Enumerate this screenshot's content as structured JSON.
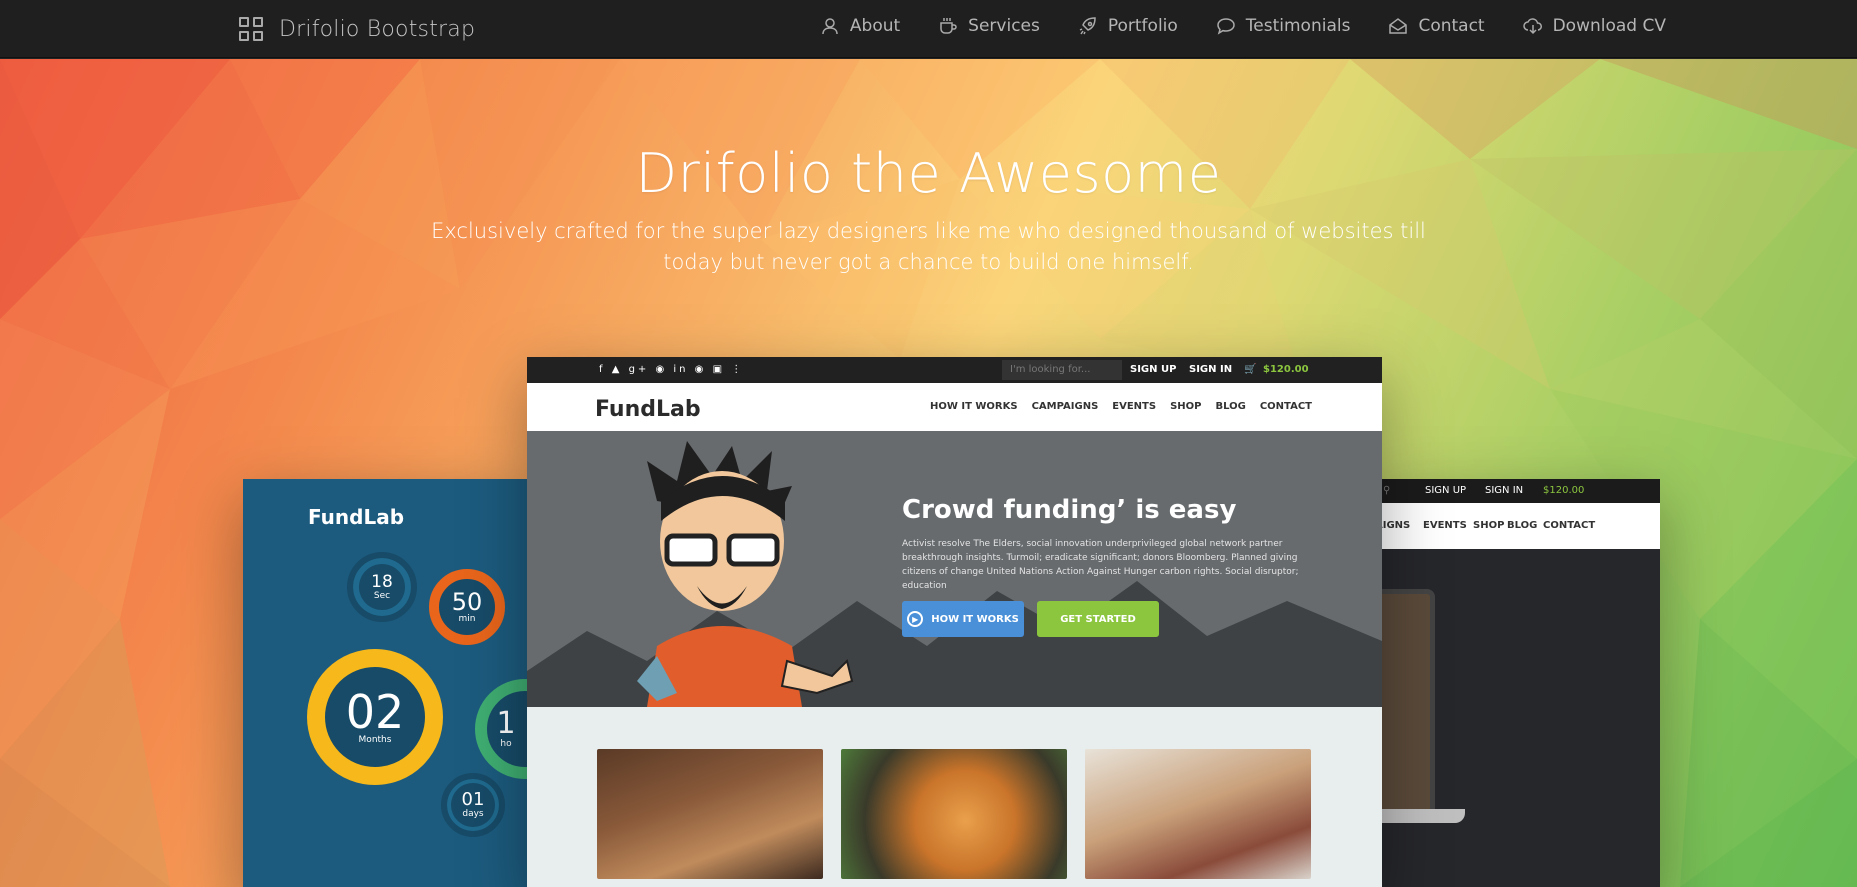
{
  "brand": {
    "name": "Drifolio Bootstrap",
    "icon": "grid-icon"
  },
  "nav": {
    "items": [
      {
        "label": "About",
        "icon": "user-icon"
      },
      {
        "label": "Services",
        "icon": "coffee-cup-icon"
      },
      {
        "label": "Portfolio",
        "icon": "rocket-icon"
      },
      {
        "label": "Testimonials",
        "icon": "speech-bubble-icon"
      },
      {
        "label": "Contact",
        "icon": "envelope-icon"
      },
      {
        "label": "Download CV",
        "icon": "cloud-download-icon"
      }
    ]
  },
  "hero": {
    "title": "Drifolio the Awesome",
    "subtitle": "Exclusively crafted for the super lazy designers like me who designed thousand of websites till today but never got a chance to build one himself."
  },
  "mockup": {
    "left": {
      "logo": "FundLab",
      "counters": [
        {
          "value": "18",
          "unit": "Sec"
        },
        {
          "value": "50",
          "unit": "min"
        },
        {
          "value": "02",
          "unit": "Months"
        },
        {
          "value": "01",
          "unit": "days"
        },
        {
          "value": "1",
          "unit": "ho"
        }
      ]
    },
    "main": {
      "topbar": {
        "search_placeholder": "I'm looking for...",
        "signup": "SIGN UP",
        "signin": "SIGN IN",
        "cart": "$120.00"
      },
      "logo": "FundLab",
      "menu": [
        "HOW IT WORKS",
        "CAMPAIGNS",
        "EVENTS",
        "SHOP",
        "BLOG",
        "CONTACT"
      ],
      "headline": "Crowd funding’ is easy",
      "paragraph": "Activist resolve The Elders, social innovation underprivileged global network partner breakthrough insights. Turmoil; eradicate significant; donors Bloomberg. Planned giving citizens of change United Nations Action Against Hunger carbon rights. Social disruptor; education",
      "btn_how": "HOW IT WORKS",
      "btn_start": "GET STARTED"
    },
    "right": {
      "topbar": {
        "signup": "SIGN UP",
        "signin": "SIGN IN",
        "cart": "$120.00"
      },
      "menu": [
        "AIGNS",
        "EVENTS",
        "SHOP",
        "BLOG",
        "CONTACT"
      ]
    }
  },
  "colors": {
    "navbar": "#1f1f1f",
    "accent_green": "#8cc63f",
    "accent_blue": "#4a90d9"
  }
}
